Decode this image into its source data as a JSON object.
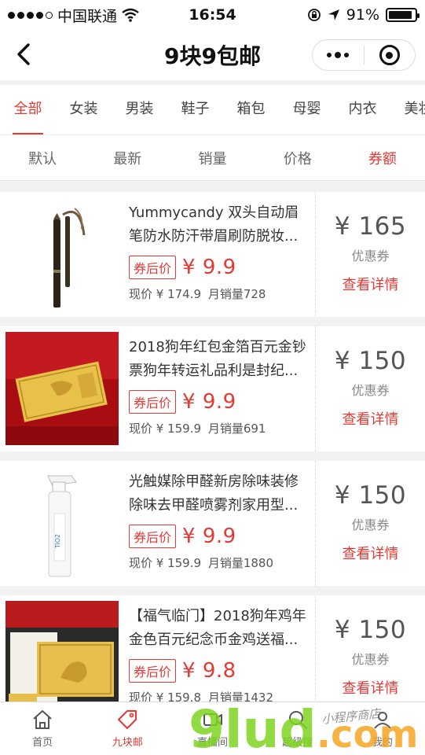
{
  "status_bar": {
    "carrier": "中国联通",
    "time": "16:54",
    "battery": "91%",
    "battery_level": 0.91
  },
  "nav": {
    "title": "9块9包邮"
  },
  "categories": [
    "全部",
    "女装",
    "男装",
    "鞋子",
    "箱包",
    "母婴",
    "内衣",
    "美妆"
  ],
  "sort_tabs": [
    "默认",
    "最新",
    "销量",
    "价格",
    "券额"
  ],
  "products": [
    {
      "title": "Yummycandy 双头自动眉笔防水防汗带眉刷防脱妆...",
      "tag": "券后价",
      "price": "¥ 9.9",
      "original": "现价 ¥ 174.9",
      "sales": "月销量728",
      "coupon": "¥ 165",
      "coupon_label": "优惠券",
      "detail": "查看详情"
    },
    {
      "title": "2018狗年红包金箔百元金钞票狗年转运礼品利是封纪...",
      "tag": "券后价",
      "price": "¥ 9.9",
      "original": "现价 ¥ 159.9",
      "sales": "月销量691",
      "coupon": "¥ 150",
      "coupon_label": "优惠券",
      "detail": "查看详情"
    },
    {
      "title": "光触媒除甲醛新房除味装修除味去甲醛喷雾剂家用型...",
      "tag": "券后价",
      "price": "¥ 9.9",
      "original": "现价 ¥ 159.9",
      "sales": "月销量1880",
      "coupon": "¥ 150",
      "coupon_label": "优惠券",
      "detail": "查看详情"
    },
    {
      "title": "【福气临门】2018狗年鸡年金色百元纪念币金鸡送福...",
      "tag": "券后价",
      "price": "¥ 9.8",
      "original": "现价 ¥ 159.8",
      "sales": "月销量1432",
      "coupon": "¥ 150",
      "coupon_label": "优惠券",
      "detail": "查看详情"
    }
  ],
  "tabbar": [
    {
      "label": "首页",
      "icon": "home-icon"
    },
    {
      "label": "九块邮",
      "icon": "tag-icon"
    },
    {
      "label": "直播间",
      "icon": "video-icon"
    },
    {
      "label": "超级搜",
      "icon": "search-icon"
    },
    {
      "label": "我的",
      "icon": "user-icon"
    }
  ],
  "watermark": {
    "text": "9lud.com",
    "subtext": "小程序商店"
  },
  "colors": {
    "accent": "#e53935",
    "watermark_green": "#7ed321",
    "watermark_orange": "#f5a623"
  }
}
